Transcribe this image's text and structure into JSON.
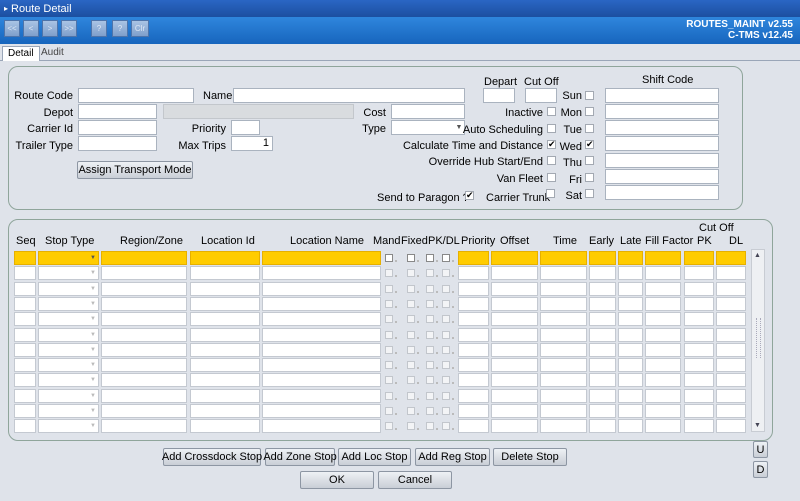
{
  "window": {
    "title": "Route Detail"
  },
  "toolbar": {
    "buttons": [
      "<<",
      "<",
      ">",
      ">>",
      "?",
      "?",
      "Clr"
    ]
  },
  "version": {
    "line1": "ROUTES_MAINT v2.55",
    "line2": "C-TMS v12.45"
  },
  "tabs": {
    "detail": "Detail",
    "audit": "Audit"
  },
  "form": {
    "route_code": "Route Code",
    "name": "Name",
    "depot": "Depot",
    "cost": "Cost",
    "carrier_id": "Carrier Id",
    "priority": "Priority",
    "type": "Type",
    "trailer_type": "Trailer Type",
    "max_trips": "Max Trips",
    "max_trips_value": "1",
    "depart": "Depart",
    "cut_off": "Cut Off",
    "shift_code": "Shift Code",
    "inactive": "Inactive",
    "auto_scheduling": "Auto Scheduling",
    "calc_time_distance": "Calculate Time and Distance",
    "override_hub": "Override Hub Start/End",
    "van_fleet": "Van Fleet",
    "send_paragon": "Send to Paragon ?",
    "carrier_trunk": "Carrier Trunk",
    "assign_transport": "Assign Transport Mode",
    "days": [
      "Sun",
      "Mon",
      "Tue",
      "Wed",
      "Thu",
      "Fri",
      "Sat"
    ],
    "checks": {
      "inactive": false,
      "auto_scheduling": false,
      "calc_time_distance": true,
      "override_hub": false,
      "van_fleet": false,
      "send_paragon": true,
      "carrier_trunk": false,
      "wed": true
    }
  },
  "grid": {
    "headers": {
      "seq": "Seq",
      "stop_type": "Stop Type",
      "region_zone": "Region/Zone",
      "location_id": "Location Id",
      "location_name": "Location Name",
      "mand": "Mand",
      "fixed": "Fixed",
      "pkdl": "PK/DL",
      "priority": "Priority",
      "offset": "Offset",
      "time": "Time",
      "early": "Early",
      "late": "Late",
      "fill_factor": "Fill Factor",
      "cut_off": "Cut Off",
      "pk": "PK",
      "dl": "DL"
    }
  },
  "buttons": {
    "add_crossdock": "Add Crossdock Stop",
    "add_zone": "Add Zone Stop",
    "add_loc": "Add Loc Stop",
    "add_reg": "Add Reg Stop",
    "delete_stop": "Delete Stop",
    "ok": "OK",
    "cancel": "Cancel",
    "up": "U",
    "down": "D"
  },
  "icons": {
    "check": "✔"
  },
  "colors": {
    "title": "#1c4fa0",
    "toolbar": "#1765bd",
    "selected_row": "#ffcc00"
  }
}
